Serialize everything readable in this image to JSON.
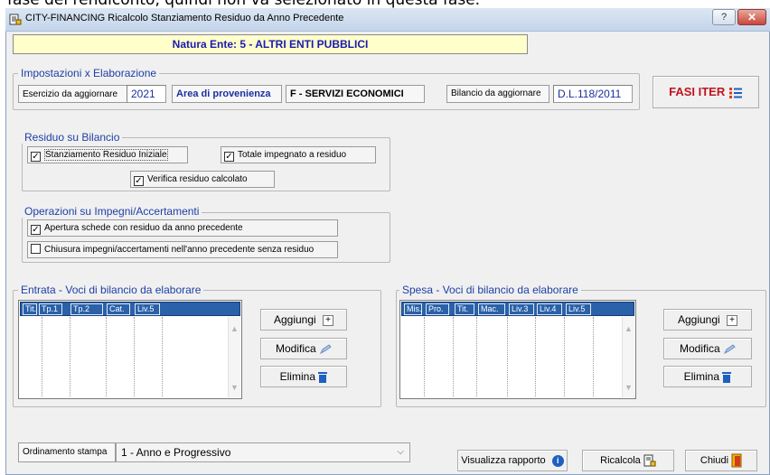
{
  "background_caption": "fase del rendiconto, quindi non va selezionato in questa fase.",
  "window": {
    "title": "CITY-FINANCING  Ricalcolo Stanziamento Residuo da Anno Precedente",
    "help_glyph": "?",
    "close_glyph": "✕"
  },
  "natura_ente": "Natura Ente:   5 - ALTRI ENTI PUBBLICI",
  "impostazioni": {
    "title": "Impostazioni x Elaborazione",
    "esercizio_label": "Esercizio da aggiornare",
    "esercizio_value": "2021",
    "area_label": "Area di provenienza",
    "area_value": "F - SERVIZI ECONOMICI",
    "bilancio_label": "Bilancio da aggiornare",
    "bilancio_value": "D.L.118/2011"
  },
  "fasi_iter_label": "FASI ITER",
  "residuo": {
    "title": "Residuo su Bilancio",
    "stanziamento": {
      "label": "Stanziamento Residuo Iniziale",
      "checked": true
    },
    "totale": {
      "label": "Totale impegnato a residuo",
      "checked": true
    },
    "verifica": {
      "label": "Verifica residuo calcolato",
      "checked": true
    }
  },
  "operazioni": {
    "title": "Operazioni su Impegni/Accertamenti",
    "apertura": {
      "label": "Apertura schede con residuo da anno precedente",
      "checked": true
    },
    "chiusura": {
      "label": "Chiusura impegni/accertamenti nell'anno precedente senza residuo",
      "checked": false
    }
  },
  "entrata": {
    "title": "Entrata - Voci di bilancio da elaborare",
    "columns": [
      "Tit.",
      "Tp.1",
      "Tp.2",
      "Cat.",
      "Liv.5"
    ]
  },
  "spesa": {
    "title": "Spesa - Voci di bilancio da elaborare",
    "columns": [
      "Mis.",
      "Pro.",
      "Tit.",
      "Mac.",
      "Liv.3",
      "Liv.4",
      "Liv.5"
    ]
  },
  "buttons": {
    "aggiungi": "Aggiungi",
    "modifica": "Modifica",
    "elimina": "Elimina",
    "visualizza": "Visualizza rapporto",
    "ricalcola": "Ricalcola",
    "chiudi": "Chiudi"
  },
  "ordinamento": {
    "label": "Ordinamento stampa",
    "selected": "1 - Anno e Progressivo"
  },
  "colors": {
    "group_title": "#1e3fa5",
    "grid_header": "#2a61a8",
    "natura_bg": "#ffffcc",
    "fasi_iter": "#c0141e"
  }
}
